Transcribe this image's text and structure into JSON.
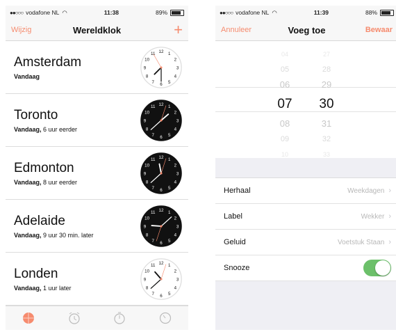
{
  "left": {
    "status": {
      "carrier": "vodafone NL",
      "time": "11:38",
      "battery": "89%"
    },
    "nav": {
      "edit": "Wijzig",
      "title": "Wereldklok",
      "add": "+"
    },
    "clocks": [
      {
        "city": "Amsterdam",
        "day": "Vandaag",
        "offset": "",
        "hour": 7,
        "minute": 30,
        "dark": false
      },
      {
        "city": "Toronto",
        "day": "Vandaag,",
        "offset": "6 uur eerder",
        "hour": 1,
        "minute": 38,
        "dark": true
      },
      {
        "city": "Edmonton",
        "day": "Vandaag,",
        "offset": "8 uur eerder",
        "hour": 11,
        "minute": 38,
        "dark": true
      },
      {
        "city": "Adelaide",
        "day": "Vandaag,",
        "offset": "9 uur 30 min. later",
        "hour": 9,
        "minute": 8,
        "dark": true
      },
      {
        "city": "Londen",
        "day": "Vandaag,",
        "offset": "1 uur later",
        "hour": 10,
        "minute": 38,
        "dark": false
      }
    ],
    "tabs": [
      "world-clock",
      "alarm",
      "stopwatch",
      "timer"
    ],
    "accent": "#f68b6e"
  },
  "right": {
    "status": {
      "carrier": "vodafone NL",
      "time": "11:39",
      "battery": "88%"
    },
    "nav": {
      "cancel": "Annuleer",
      "title": "Voeg toe",
      "save": "Bewaar"
    },
    "picker": {
      "hours": [
        "04",
        "05",
        "06",
        "07",
        "08",
        "09",
        "10"
      ],
      "minutes": [
        "27",
        "28",
        "29",
        "30",
        "31",
        "32",
        "33"
      ],
      "selected_index": 3
    },
    "settings": [
      {
        "label": "Herhaal",
        "value": "Weekdagen",
        "chevron": true
      },
      {
        "label": "Label",
        "value": "Wekker",
        "chevron": true
      },
      {
        "label": "Geluid",
        "value": "Voetstuk Staan",
        "chevron": true
      },
      {
        "label": "Snooze",
        "toggle": true,
        "on": true
      }
    ],
    "toggle_color": "#6cc06a"
  }
}
